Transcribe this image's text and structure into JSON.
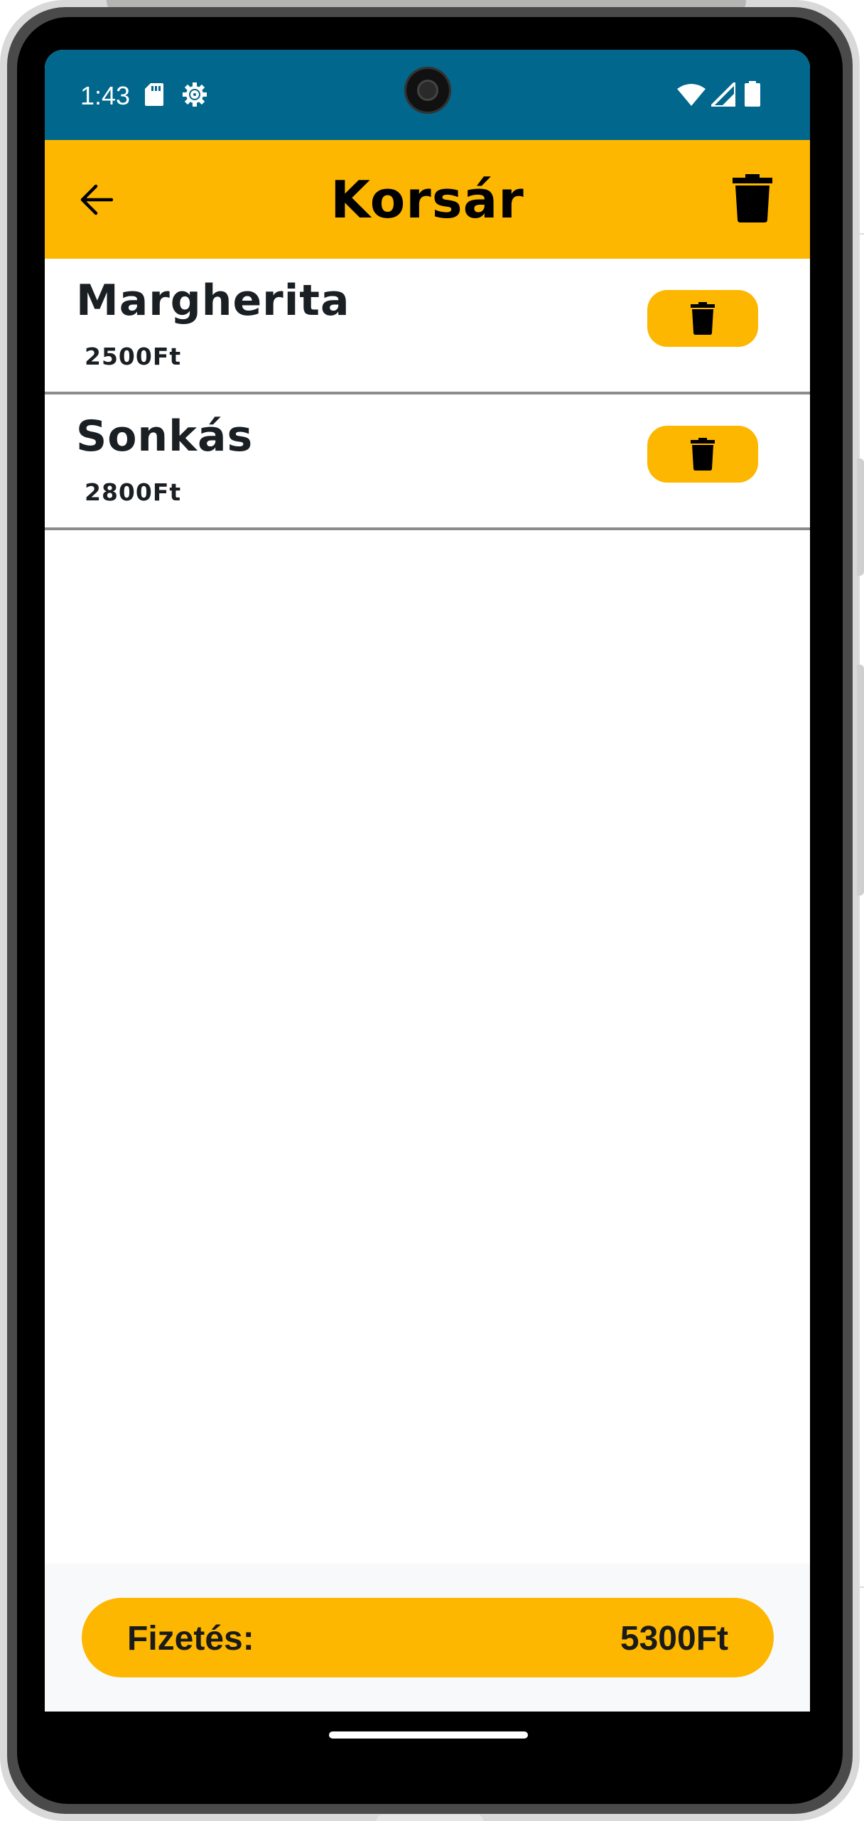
{
  "status_bar": {
    "time": "1:43",
    "icons": [
      "sd-card-icon",
      "settings-gear-icon",
      "wifi-icon",
      "cell-signal-icon",
      "battery-icon"
    ]
  },
  "app_bar": {
    "title": "Korsár",
    "back_icon": "arrow-left-icon",
    "clear_icon": "trash-icon"
  },
  "cart": {
    "items": [
      {
        "name": "Margherita",
        "price": "2500Ft"
      },
      {
        "name": "Sonkás",
        "price": "2800Ft"
      }
    ]
  },
  "footer": {
    "pay_label": "Fizetés:",
    "total": "5300Ft"
  },
  "colors": {
    "status_bar": "#02678c",
    "accent": "#fdb700",
    "text_dark": "#1a1f24",
    "divider": "#8c8c8c"
  }
}
